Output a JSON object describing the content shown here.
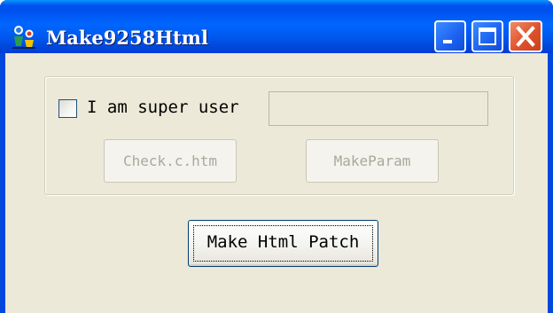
{
  "window": {
    "title": "Make9258Html",
    "app_icon": "application-icon",
    "title_bar_color": "#0054e3",
    "body_color": "#ece9d8"
  },
  "title_buttons": {
    "minimize_icon": "minimize-icon",
    "maximize_icon": "maximize-icon",
    "close_icon": "close-icon"
  },
  "super_user": {
    "checkbox_label": "I am super user",
    "checked": false,
    "input_value": ""
  },
  "buttons": {
    "check_label": "Check.c.htm",
    "make_param_label": "MakeParam",
    "make_patch_label": "Make Html Patch"
  }
}
